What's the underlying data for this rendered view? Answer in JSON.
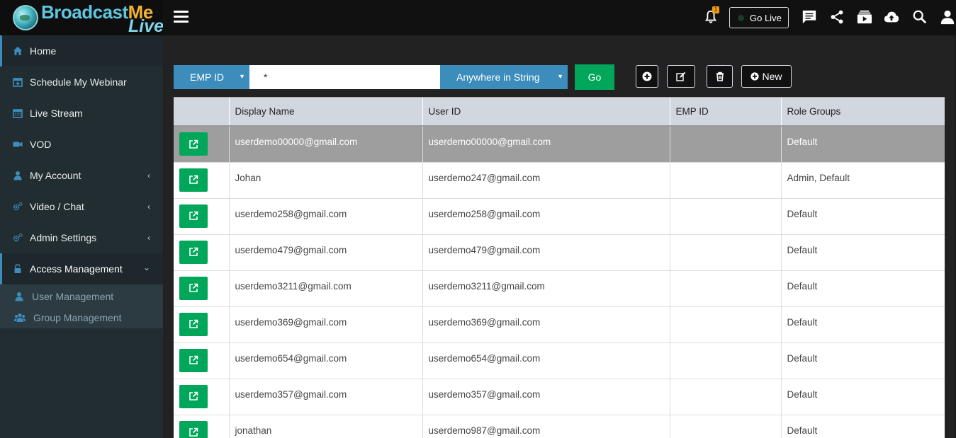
{
  "brand": {
    "name_part1": "Broadcast",
    "name_part2": "Me",
    "name_part3": "Live"
  },
  "colors": {
    "accent": "#3c8dbc",
    "success": "#00a65a",
    "sidebar": "#222d32",
    "badge": "#f39c12"
  },
  "sidebar": {
    "items": [
      {
        "label": "Home",
        "icon": "home-icon"
      },
      {
        "label": "Schedule My Webinar",
        "icon": "calendar-plus-icon"
      },
      {
        "label": "Live Stream",
        "icon": "calendar-icon"
      },
      {
        "label": "VOD",
        "icon": "video-camera-icon"
      },
      {
        "label": "My Account",
        "icon": "user-icon"
      },
      {
        "label": "Video / Chat",
        "icon": "cogs-icon"
      },
      {
        "label": "Admin Settings",
        "icon": "cogs-icon"
      },
      {
        "label": "Access Management",
        "icon": "lock-icon"
      }
    ],
    "submenu": [
      {
        "label": "User Management",
        "icon": "user-icon"
      },
      {
        "label": "Group Management",
        "icon": "users-icon"
      }
    ]
  },
  "topbar": {
    "notification_count": "1",
    "go_live_label": "Go Live"
  },
  "search": {
    "field_select": "EMP ID",
    "query": "*",
    "match_select": "Anywhere in String",
    "go_label": "Go",
    "new_label": "New"
  },
  "table": {
    "headers": [
      "",
      "Display Name",
      "User ID",
      "EMP ID",
      "Role Groups"
    ],
    "rows": [
      {
        "display_name": "userdemo00000@gmail.com",
        "user_id": "userdemo00000@gmail.com",
        "emp_id": "",
        "role_groups": "Default"
      },
      {
        "display_name": "Johan",
        "user_id": "userdemo247@gmail.com",
        "emp_id": "",
        "role_groups": "Admin, Default"
      },
      {
        "display_name": "userdemo258@gmail.com",
        "user_id": "userdemo258@gmail.com",
        "emp_id": "",
        "role_groups": "Default"
      },
      {
        "display_name": "userdemo479@gmail.com",
        "user_id": "userdemo479@gmail.com",
        "emp_id": "",
        "role_groups": "Default"
      },
      {
        "display_name": "userdemo3211@gmail.com",
        "user_id": "userdemo3211@gmail.com",
        "emp_id": "",
        "role_groups": "Default"
      },
      {
        "display_name": "userdemo369@gmail.com",
        "user_id": "userdemo369@gmail.com",
        "emp_id": "",
        "role_groups": "Default"
      },
      {
        "display_name": "userdemo654@gmail.com",
        "user_id": "userdemo654@gmail.com",
        "emp_id": "",
        "role_groups": "Default"
      },
      {
        "display_name": "userdemo357@gmail.com",
        "user_id": "userdemo357@gmail.com",
        "emp_id": "",
        "role_groups": "Default"
      },
      {
        "display_name": "jonathan",
        "user_id": "userdemo987@gmail.com",
        "emp_id": "",
        "role_groups": "Default"
      }
    ]
  }
}
